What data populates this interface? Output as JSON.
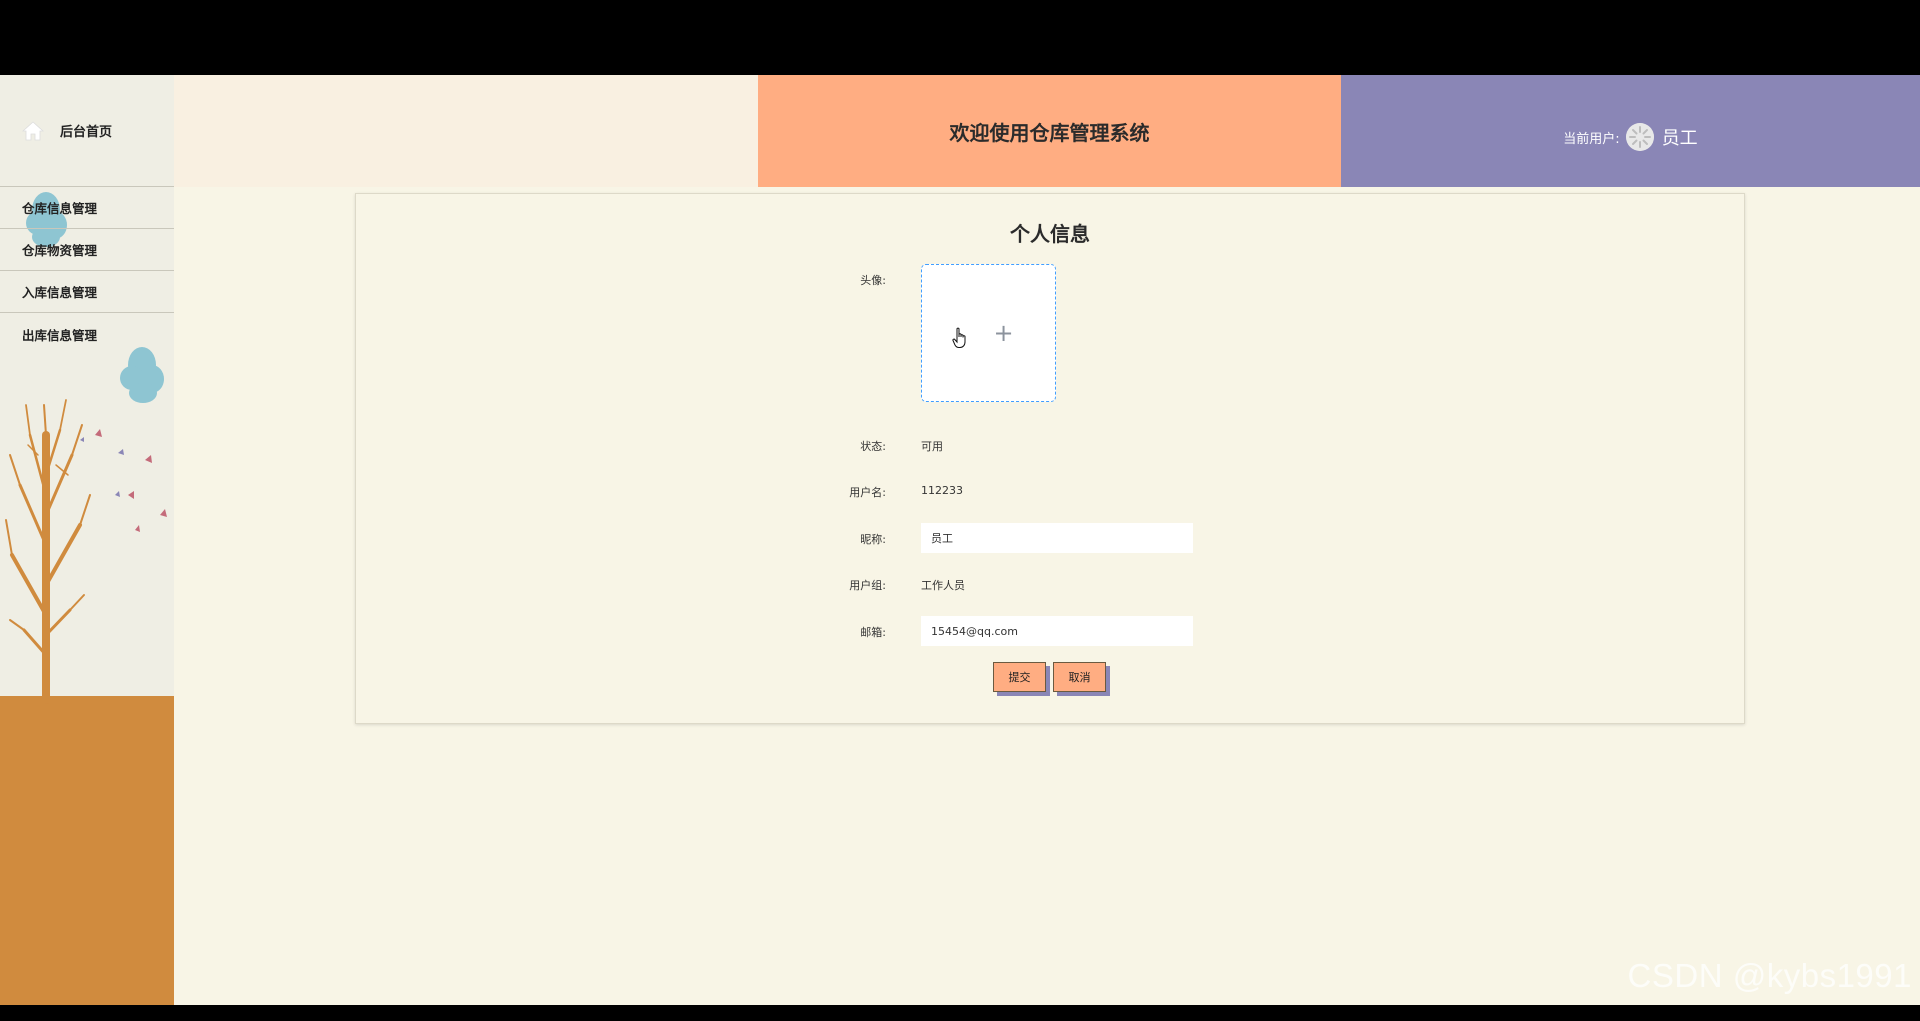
{
  "sidebar": {
    "home_label": "后台首页",
    "items": [
      {
        "label": "仓库信息管理"
      },
      {
        "label": "仓库物资管理"
      },
      {
        "label": "入库信息管理"
      },
      {
        "label": "出库信息管理"
      }
    ]
  },
  "header": {
    "title": "欢迎使用仓库管理系统",
    "current_user_label": "当前用户:",
    "user_name": "员工"
  },
  "profile": {
    "title": "个人信息",
    "avatar_label": "头像:",
    "status_label": "状态:",
    "status_value": "可用",
    "username_label": "用户名:",
    "username_value": "112233",
    "nickname_label": "昵称:",
    "nickname_value": "员工",
    "group_label": "用户组:",
    "group_value": "工作人员",
    "email_label": "邮箱:",
    "email_value": "15454@qq.com",
    "submit_label": "提交",
    "cancel_label": "取消"
  },
  "watermark": "CSDN @kybs1991",
  "colors": {
    "accent_orange": "#ffad82",
    "accent_purple": "#8a86b6",
    "page_bg": "#f8f5e6",
    "ground": "#d08b3e"
  }
}
